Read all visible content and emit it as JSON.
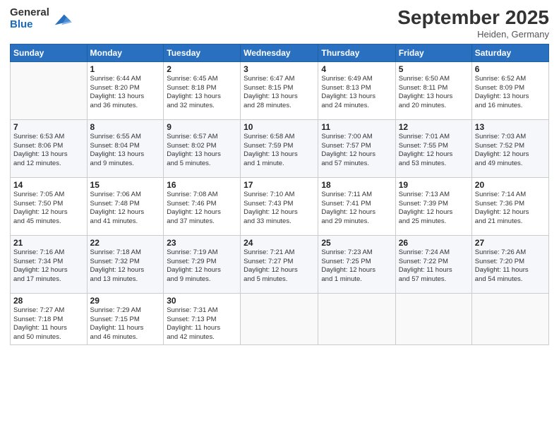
{
  "logo": {
    "general": "General",
    "blue": "Blue"
  },
  "header": {
    "title": "September 2025",
    "subtitle": "Heiden, Germany"
  },
  "weekdays": [
    "Sunday",
    "Monday",
    "Tuesday",
    "Wednesday",
    "Thursday",
    "Friday",
    "Saturday"
  ],
  "weeks": [
    [
      {
        "day": "",
        "info": ""
      },
      {
        "day": "1",
        "info": "Sunrise: 6:44 AM\nSunset: 8:20 PM\nDaylight: 13 hours\nand 36 minutes."
      },
      {
        "day": "2",
        "info": "Sunrise: 6:45 AM\nSunset: 8:18 PM\nDaylight: 13 hours\nand 32 minutes."
      },
      {
        "day": "3",
        "info": "Sunrise: 6:47 AM\nSunset: 8:15 PM\nDaylight: 13 hours\nand 28 minutes."
      },
      {
        "day": "4",
        "info": "Sunrise: 6:49 AM\nSunset: 8:13 PM\nDaylight: 13 hours\nand 24 minutes."
      },
      {
        "day": "5",
        "info": "Sunrise: 6:50 AM\nSunset: 8:11 PM\nDaylight: 13 hours\nand 20 minutes."
      },
      {
        "day": "6",
        "info": "Sunrise: 6:52 AM\nSunset: 8:09 PM\nDaylight: 13 hours\nand 16 minutes."
      }
    ],
    [
      {
        "day": "7",
        "info": "Sunrise: 6:53 AM\nSunset: 8:06 PM\nDaylight: 13 hours\nand 12 minutes."
      },
      {
        "day": "8",
        "info": "Sunrise: 6:55 AM\nSunset: 8:04 PM\nDaylight: 13 hours\nand 9 minutes."
      },
      {
        "day": "9",
        "info": "Sunrise: 6:57 AM\nSunset: 8:02 PM\nDaylight: 13 hours\nand 5 minutes."
      },
      {
        "day": "10",
        "info": "Sunrise: 6:58 AM\nSunset: 7:59 PM\nDaylight: 13 hours\nand 1 minute."
      },
      {
        "day": "11",
        "info": "Sunrise: 7:00 AM\nSunset: 7:57 PM\nDaylight: 12 hours\nand 57 minutes."
      },
      {
        "day": "12",
        "info": "Sunrise: 7:01 AM\nSunset: 7:55 PM\nDaylight: 12 hours\nand 53 minutes."
      },
      {
        "day": "13",
        "info": "Sunrise: 7:03 AM\nSunset: 7:52 PM\nDaylight: 12 hours\nand 49 minutes."
      }
    ],
    [
      {
        "day": "14",
        "info": "Sunrise: 7:05 AM\nSunset: 7:50 PM\nDaylight: 12 hours\nand 45 minutes."
      },
      {
        "day": "15",
        "info": "Sunrise: 7:06 AM\nSunset: 7:48 PM\nDaylight: 12 hours\nand 41 minutes."
      },
      {
        "day": "16",
        "info": "Sunrise: 7:08 AM\nSunset: 7:46 PM\nDaylight: 12 hours\nand 37 minutes."
      },
      {
        "day": "17",
        "info": "Sunrise: 7:10 AM\nSunset: 7:43 PM\nDaylight: 12 hours\nand 33 minutes."
      },
      {
        "day": "18",
        "info": "Sunrise: 7:11 AM\nSunset: 7:41 PM\nDaylight: 12 hours\nand 29 minutes."
      },
      {
        "day": "19",
        "info": "Sunrise: 7:13 AM\nSunset: 7:39 PM\nDaylight: 12 hours\nand 25 minutes."
      },
      {
        "day": "20",
        "info": "Sunrise: 7:14 AM\nSunset: 7:36 PM\nDaylight: 12 hours\nand 21 minutes."
      }
    ],
    [
      {
        "day": "21",
        "info": "Sunrise: 7:16 AM\nSunset: 7:34 PM\nDaylight: 12 hours\nand 17 minutes."
      },
      {
        "day": "22",
        "info": "Sunrise: 7:18 AM\nSunset: 7:32 PM\nDaylight: 12 hours\nand 13 minutes."
      },
      {
        "day": "23",
        "info": "Sunrise: 7:19 AM\nSunset: 7:29 PM\nDaylight: 12 hours\nand 9 minutes."
      },
      {
        "day": "24",
        "info": "Sunrise: 7:21 AM\nSunset: 7:27 PM\nDaylight: 12 hours\nand 5 minutes."
      },
      {
        "day": "25",
        "info": "Sunrise: 7:23 AM\nSunset: 7:25 PM\nDaylight: 12 hours\nand 1 minute."
      },
      {
        "day": "26",
        "info": "Sunrise: 7:24 AM\nSunset: 7:22 PM\nDaylight: 11 hours\nand 57 minutes."
      },
      {
        "day": "27",
        "info": "Sunrise: 7:26 AM\nSunset: 7:20 PM\nDaylight: 11 hours\nand 54 minutes."
      }
    ],
    [
      {
        "day": "28",
        "info": "Sunrise: 7:27 AM\nSunset: 7:18 PM\nDaylight: 11 hours\nand 50 minutes."
      },
      {
        "day": "29",
        "info": "Sunrise: 7:29 AM\nSunset: 7:15 PM\nDaylight: 11 hours\nand 46 minutes."
      },
      {
        "day": "30",
        "info": "Sunrise: 7:31 AM\nSunset: 7:13 PM\nDaylight: 11 hours\nand 42 minutes."
      },
      {
        "day": "",
        "info": ""
      },
      {
        "day": "",
        "info": ""
      },
      {
        "day": "",
        "info": ""
      },
      {
        "day": "",
        "info": ""
      }
    ]
  ]
}
